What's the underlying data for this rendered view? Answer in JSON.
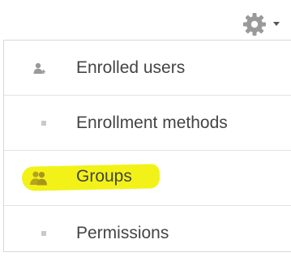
{
  "header": {
    "settings_icon": "gear-icon",
    "dropdown_icon": "caret-down-icon"
  },
  "menu": {
    "items": [
      {
        "label": "Enrolled users",
        "icon": "enrolled-users-icon"
      },
      {
        "label": "Enrollment methods",
        "icon": "bullet-icon"
      },
      {
        "label": "Groups",
        "icon": "groups-icon",
        "highlight_color": "#f2f218"
      },
      {
        "label": "Permissions",
        "icon": "bullet-icon"
      }
    ]
  },
  "colors": {
    "text": "#444444",
    "icon": "#9a9a9a",
    "highlight": "#f2f218",
    "divider": "#e3e3e3"
  }
}
